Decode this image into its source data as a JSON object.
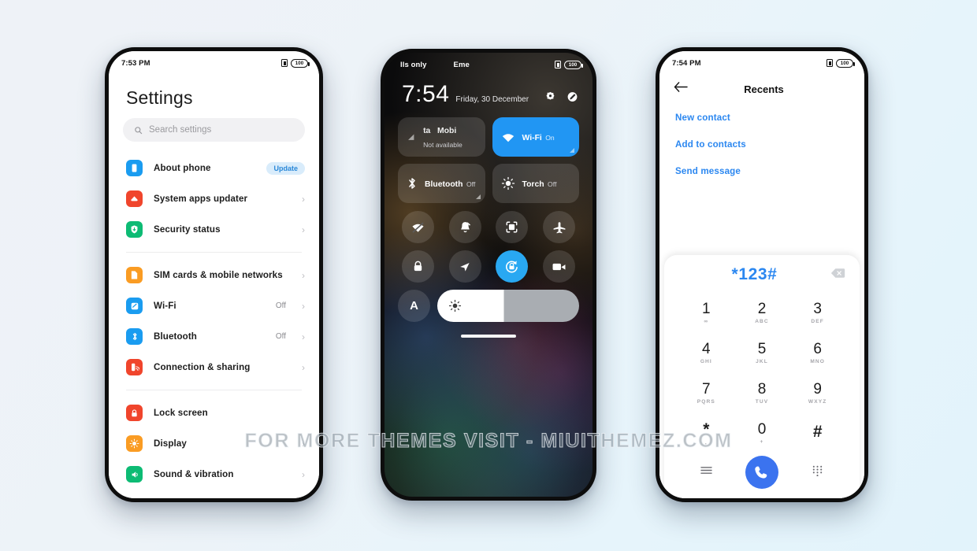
{
  "background": {
    "color_start": "#eef2f7",
    "color_end": "#e2f3fb"
  },
  "watermark": {
    "text": "FOR MORE THEMES VISIT - MIUITHEMEZ.COM"
  },
  "phone_settings": {
    "statusbar": {
      "time": "7:53 PM",
      "battery": "100",
      "sim_icon": "sim-card-icon"
    },
    "title": "Settings",
    "search": {
      "placeholder": "Search settings",
      "icon": "search-icon"
    },
    "groups": [
      {
        "items": [
          {
            "label": "About phone",
            "icon": "phone-info-icon",
            "icon_color": "#1a9cf0",
            "badge": "Update",
            "value": "",
            "chevron": false
          },
          {
            "label": "System apps updater",
            "icon": "system-updater-icon",
            "icon_color": "#f0452c",
            "badge": "",
            "value": "",
            "chevron": true
          },
          {
            "label": "Security status",
            "icon": "security-shield-icon",
            "icon_color": "#0dbb74",
            "badge": "",
            "value": "",
            "chevron": true
          }
        ]
      },
      {
        "items": [
          {
            "label": "SIM cards & mobile networks",
            "icon": "sim-cards-icon",
            "icon_color": "#fa9c23",
            "badge": "",
            "value": "",
            "chevron": true
          },
          {
            "label": "Wi-Fi",
            "icon": "wifi-settings-icon",
            "icon_color": "#1a9cf0",
            "badge": "",
            "value": "Off",
            "chevron": true
          },
          {
            "label": "Bluetooth",
            "icon": "bluetooth-settings-icon",
            "icon_color": "#1a9cf0",
            "badge": "",
            "value": "Off",
            "chevron": true
          },
          {
            "label": "Connection & sharing",
            "icon": "connection-sharing-icon",
            "icon_color": "#f0452c",
            "badge": "",
            "value": "",
            "chevron": true
          }
        ]
      },
      {
        "items": [
          {
            "label": "Lock screen",
            "icon": "lock-screen-icon",
            "icon_color": "#f0452c",
            "badge": "",
            "value": "",
            "chevron": false
          },
          {
            "label": "Display",
            "icon": "display-icon",
            "icon_color": "#fa9c23",
            "badge": "",
            "value": "",
            "chevron": true
          },
          {
            "label": "Sound & vibration",
            "icon": "sound-vibration-icon",
            "icon_color": "#0dbb74",
            "badge": "",
            "value": "",
            "chevron": true
          }
        ]
      }
    ]
  },
  "phone_control_center": {
    "statusbar": {
      "carrier": "lls only",
      "carrier2": "Eme",
      "battery": "100",
      "sim_icon": "sim-card-icon"
    },
    "clock": {
      "time": "7:54",
      "date": "Friday, 30 December"
    },
    "header_actions": [
      {
        "name": "settings-gear-icon"
      },
      {
        "name": "edit-pencil-icon"
      }
    ],
    "big_tiles": [
      {
        "title_a": "ta",
        "title_b": "Mobi",
        "subtitle": "Not available",
        "state": "off",
        "icon": "mobile-data-icon",
        "scrolling": true
      },
      {
        "title": "Wi-Fi",
        "subtitle": "On",
        "state": "on",
        "icon": "wifi-icon",
        "scrolling": false
      },
      {
        "title": "Bluetooth",
        "subtitle": "Off",
        "state": "off",
        "icon": "bluetooth-icon",
        "scrolling": false
      },
      {
        "title": "Torch",
        "subtitle": "Off",
        "state": "off",
        "icon": "torch-icon",
        "scrolling": false
      }
    ],
    "mini_tiles": [
      {
        "icon": "hotspot-off-icon",
        "state": "off"
      },
      {
        "icon": "silent-bell-icon",
        "state": "off"
      },
      {
        "icon": "screenshot-icon",
        "state": "off"
      },
      {
        "icon": "airplane-mode-icon",
        "state": "off"
      },
      {
        "icon": "lock-icon",
        "state": "off"
      },
      {
        "icon": "location-icon",
        "state": "off"
      },
      {
        "icon": "auto-rotate-icon",
        "state": "on"
      },
      {
        "icon": "screen-record-icon",
        "state": "off"
      }
    ],
    "auto_brightness": {
      "label": "A",
      "icon": "auto-brightness-icon"
    },
    "brightness_slider": {
      "value": 47,
      "icon": "brightness-sun-icon"
    },
    "home_indicator": "home-bar"
  },
  "phone_dialer": {
    "statusbar": {
      "time": "7:54 PM",
      "battery": "100",
      "sim_icon": "sim-card-icon"
    },
    "header": {
      "back_icon": "back-arrow-icon",
      "title": "Recents"
    },
    "actions": [
      {
        "label": "New contact"
      },
      {
        "label": "Add to contacts"
      },
      {
        "label": "Send message"
      }
    ],
    "number_display": {
      "value": "*123#",
      "backspace_icon": "backspace-icon"
    },
    "keys": [
      {
        "digit": "1",
        "letters": "",
        "sub_icon": "voicemail-icon"
      },
      {
        "digit": "2",
        "letters": "ABC",
        "sub_icon": ""
      },
      {
        "digit": "3",
        "letters": "DEF",
        "sub_icon": ""
      },
      {
        "digit": "4",
        "letters": "GHI",
        "sub_icon": ""
      },
      {
        "digit": "5",
        "letters": "JKL",
        "sub_icon": ""
      },
      {
        "digit": "6",
        "letters": "MNO",
        "sub_icon": ""
      },
      {
        "digit": "7",
        "letters": "PQRS",
        "sub_icon": ""
      },
      {
        "digit": "8",
        "letters": "TUV",
        "sub_icon": ""
      },
      {
        "digit": "9",
        "letters": "WXYZ",
        "sub_icon": ""
      },
      {
        "digit": "*",
        "letters": ",",
        "sub_icon": ""
      },
      {
        "digit": "0",
        "letters": "+",
        "sub_icon": ""
      },
      {
        "digit": "#",
        "letters": "",
        "sub_icon": ""
      }
    ],
    "bottom": {
      "menu_icon": "menu-lines-icon",
      "call_icon": "call-handset-icon",
      "keypad_icon": "keypad-dots-icon",
      "call_color": "#3b73ef"
    }
  }
}
